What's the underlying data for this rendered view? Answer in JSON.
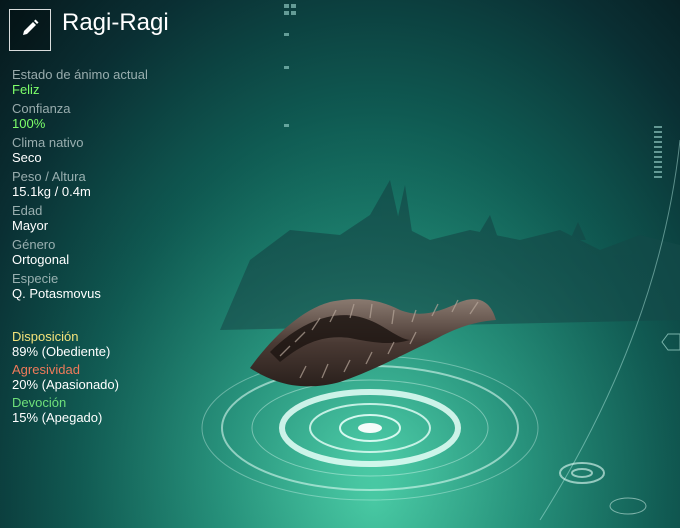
{
  "creature": {
    "name": "Ragi-Ragi"
  },
  "stats": [
    {
      "label": "Estado de ánimo actual",
      "value": "Feliz"
    },
    {
      "label": "Confianza",
      "value": "100%"
    },
    {
      "label": "Clima nativo",
      "value": "Seco"
    },
    {
      "label": "Peso / Altura",
      "value": "15.1kg / 0.4m"
    },
    {
      "label": "Edad",
      "value": "Mayor"
    },
    {
      "label": "Género",
      "value": "Ortogonal"
    },
    {
      "label": "Especie",
      "value": "Q. Potasmovus"
    }
  ],
  "traits": [
    {
      "label": "Disposición",
      "value": "89% (Obediente)",
      "color": "#f3e27a"
    },
    {
      "label": "Agresividad",
      "value": "20% (Apasionado)",
      "color": "#f07a5a"
    },
    {
      "label": "Devoción",
      "value": "15% (Apegado)",
      "color": "#6fe07a"
    }
  ],
  "colors": {
    "positive": "#7dff6a"
  },
  "icons": {
    "edit": "pencil-icon"
  }
}
